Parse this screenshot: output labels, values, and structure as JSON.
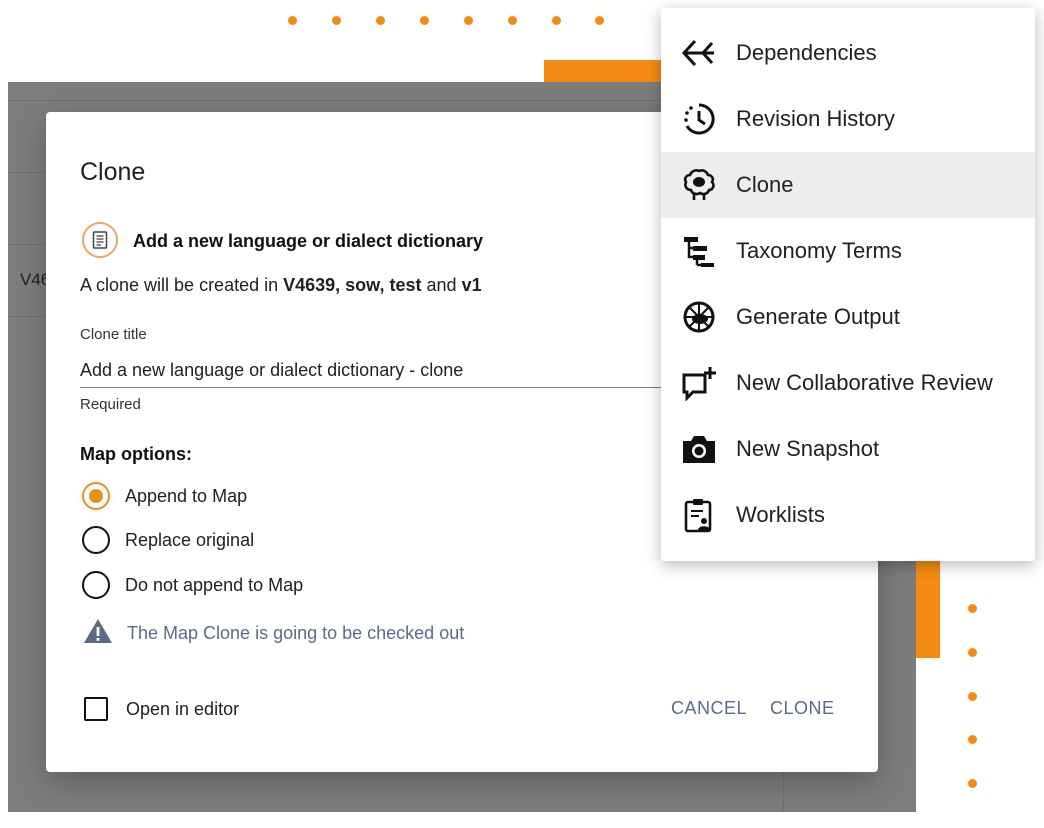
{
  "background": {
    "row_text": "V46"
  },
  "dialog": {
    "title": "Clone",
    "document_title": "Add a new language or dialect dictionary",
    "clone_info": {
      "prefix": "A clone will be created in ",
      "location": "V4639, sow, test",
      "joiner": " and ",
      "version": "v1"
    },
    "clone_title_label": "Clone title",
    "clone_title_value": "Add a new language or dialect dictionary - clone",
    "clone_title_helper": "Required",
    "map_options_label": "Map options:",
    "map_options": [
      {
        "label": "Append to Map",
        "selected": true
      },
      {
        "label": "Replace original",
        "selected": false
      },
      {
        "label": "Do not append to Map",
        "selected": false
      }
    ],
    "warning_icon": "warning-triangle-icon",
    "warning_text": "The Map Clone is going to be checked out",
    "open_in_editor_label": "Open in editor",
    "open_in_editor_checked": false,
    "cancel_label": "CANCEL",
    "clone_label": "CLONE"
  },
  "menu": {
    "items": [
      {
        "label": "Dependencies",
        "icon": "dependencies-icon",
        "active": false
      },
      {
        "label": "Revision History",
        "icon": "history-clock-icon",
        "active": false
      },
      {
        "label": "Clone",
        "icon": "sheep-icon",
        "active": true
      },
      {
        "label": "Taxonomy Terms",
        "icon": "taxonomy-tree-icon",
        "active": false
      },
      {
        "label": "Generate Output",
        "icon": "generate-output-icon",
        "active": false
      },
      {
        "label": "New Collaborative Review",
        "icon": "add-comment-icon",
        "active": false
      },
      {
        "label": "New Snapshot",
        "icon": "camera-icon",
        "active": false
      },
      {
        "label": "Worklists",
        "icon": "worklist-clipboard-icon",
        "active": false
      }
    ]
  },
  "colors": {
    "accent": "#f58b14",
    "muted_button": "#5b6b87",
    "menu_active_bg": "#eeeeee",
    "overlay": "#7d7d7d"
  }
}
